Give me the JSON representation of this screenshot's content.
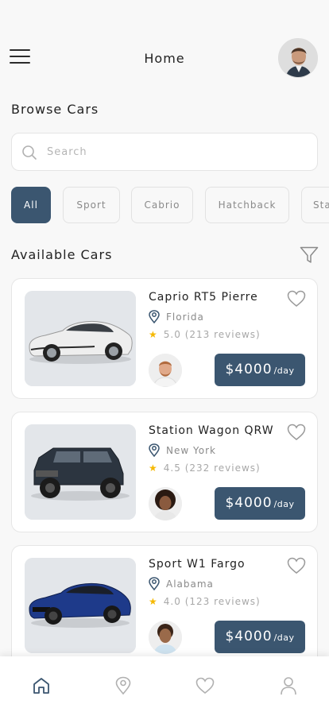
{
  "header": {
    "title": "Home"
  },
  "browse": {
    "title": "Browse Cars"
  },
  "search": {
    "placeholder": "Search"
  },
  "categories": [
    "All",
    "Sport",
    "Cabrio",
    "Hatchback",
    "Station"
  ],
  "available": {
    "title": "Available Cars"
  },
  "cars": [
    {
      "name": "Caprio RT5 Pierre",
      "location": "Florida",
      "rating": "5.0",
      "reviews": "(213 reviews)",
      "price": "$4000",
      "unit": "/day",
      "body_color": "#eeeeee"
    },
    {
      "name": "Station Wagon QRW",
      "location": "New York",
      "rating": "4.5",
      "reviews": "(232 reviews)",
      "price": "$4000",
      "unit": "/day",
      "body_color": "#2c3540"
    },
    {
      "name": "Sport W1 Fargo",
      "location": "Alabama",
      "rating": "4.0",
      "reviews": "(123 reviews)",
      "price": "$4000",
      "unit": "/day",
      "body_color": "#1e3a8a"
    }
  ],
  "colors": {
    "accent": "#3b5670",
    "star": "#f5b800",
    "bg": "#f8f8f8"
  },
  "tabs": [
    "home-icon",
    "location-icon",
    "heart-icon",
    "user-icon"
  ]
}
